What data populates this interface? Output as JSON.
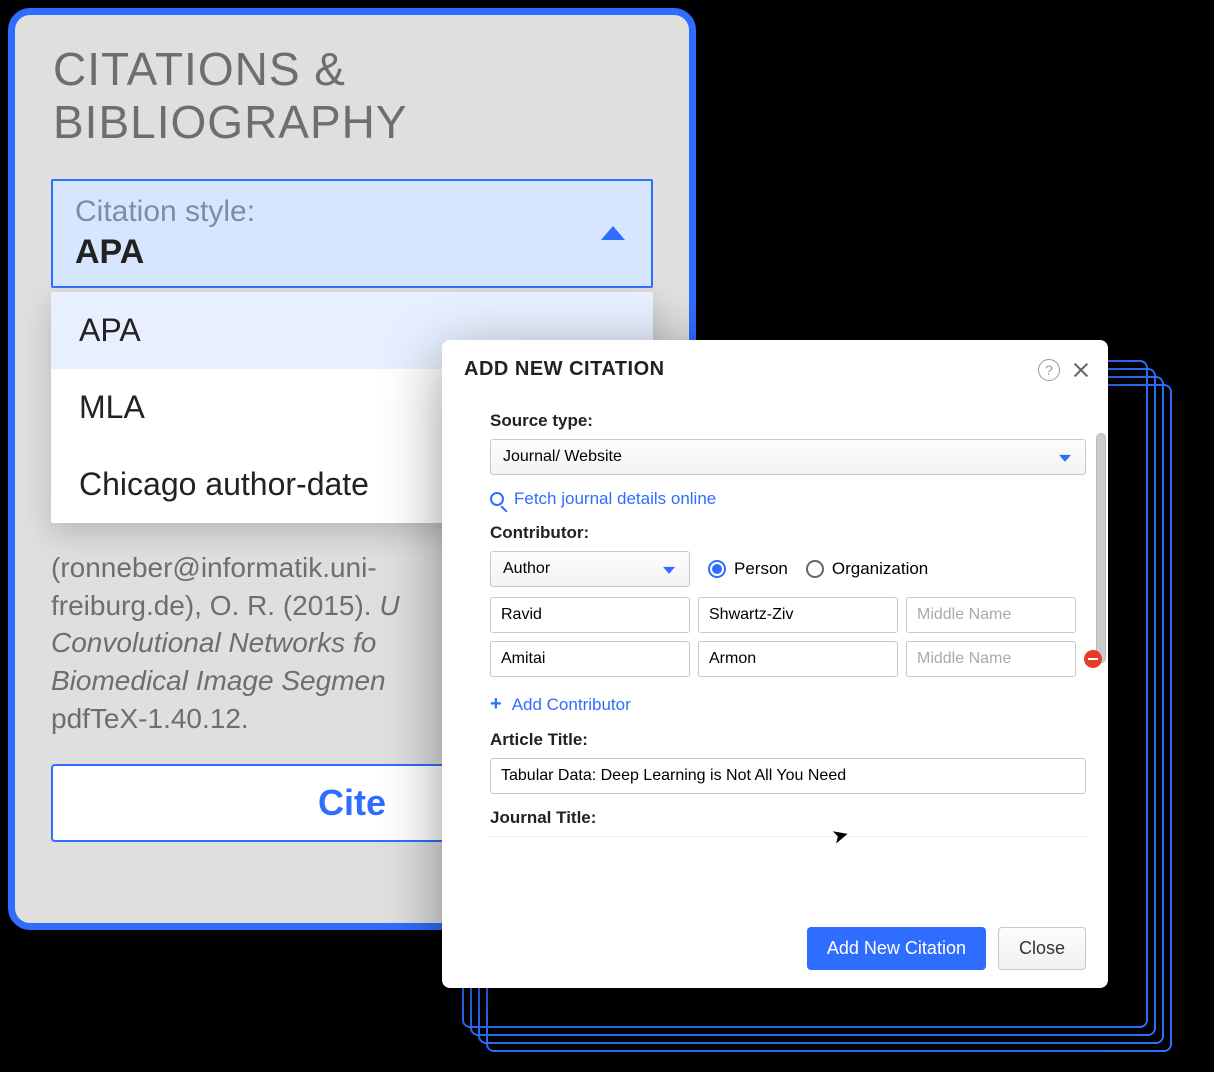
{
  "panel": {
    "title": "CITATIONS & BIBLIOGRAPHY",
    "style_label": "Citation style:",
    "style_value": "APA",
    "options": [
      "APA",
      "MLA",
      "Chicago author-date"
    ],
    "preview_line1": "(ronneber@informatik.uni-",
    "preview_line2": "freiburg.de), O. R. (2015).",
    "preview_line3": "Convolutional Networks fo",
    "preview_line4": "Biomedical Image Segmen",
    "preview_line5": "pdfTeX-1.40.12.",
    "cite_button": "Cite"
  },
  "dialog": {
    "title": "ADD NEW CITATION",
    "source_type_label": "Source type:",
    "source_type_value": "Journal/ Website",
    "fetch_link": "Fetch journal details online",
    "contributor_label": "Contributor:",
    "contributor_type": "Author",
    "radio_person": "Person",
    "radio_org": "Organization",
    "rows": [
      {
        "first": "Ravid",
        "last": "Shwartz-Ziv",
        "middle_placeholder": "Middle Name"
      },
      {
        "first": "Amitai",
        "last": "Armon",
        "middle_placeholder": "Middle Name"
      }
    ],
    "add_contributor": "Add Contributor",
    "article_title_label": "Article Title:",
    "article_title_value": "Tabular Data: Deep Learning is Not All You Need",
    "journal_title_label": "Journal Title:",
    "btn_primary": "Add New Citation",
    "btn_close": "Close"
  }
}
